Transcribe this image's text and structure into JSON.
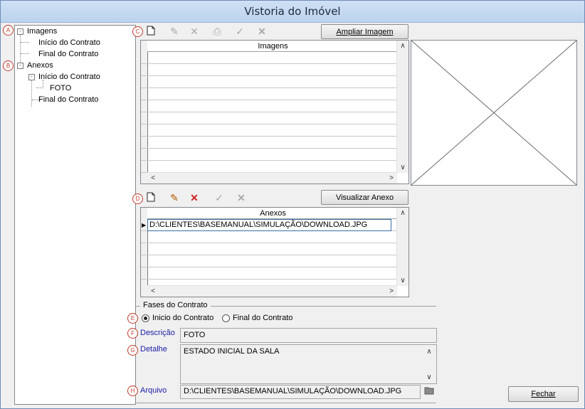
{
  "window": {
    "title": "Vistoria do Imóvel"
  },
  "tree": {
    "nodes": [
      {
        "label": "Imagens",
        "expander": "-"
      },
      {
        "label": "Início do Contrato"
      },
      {
        "label": "Final do Contrato"
      },
      {
        "label": "Anexos",
        "expander": "-"
      },
      {
        "label": "Início do Contrato",
        "expander": "-"
      },
      {
        "label": "FOTO"
      },
      {
        "label": "Final do Contrato"
      }
    ]
  },
  "markers": {
    "a": "A",
    "b": "B",
    "c": "C",
    "d": "D",
    "e": "E",
    "f": "F",
    "g": "G",
    "h": "H"
  },
  "images_panel": {
    "toolbar": {
      "new_icon": "new-document-icon",
      "edit_icon": "pencil-icon",
      "delete_icon": "x-icon",
      "print_icon": "printer-icon",
      "confirm_icon": "check-icon",
      "cancel_icon": "cancel-icon"
    },
    "zoom_button": "Ampliar Imagem",
    "grid_header": "Imagens"
  },
  "attachments_panel": {
    "view_button": "Visualizar Anexo",
    "grid_header": "Anexos",
    "rows": [
      "D:\\CLIENTES\\BASEMANUAL\\SIMULAÇÃO\\DOWNLOAD.JPG"
    ]
  },
  "phases": {
    "group_label": "Fases do Contrato",
    "option_start": "Inicio do Contrato",
    "option_end": "Final do Contrato",
    "selected": "Inicio do Contrato"
  },
  "form": {
    "description_label": "Descrição",
    "description_value": "FOTO",
    "detail_label": "Detalhe",
    "detail_value": "ESTADO INICIAL DA SALA",
    "file_label": "Arquivo",
    "file_value": "D:\\CLIENTES\\BASEMANUAL\\SIMULAÇÃO\\DOWNLOAD.JPG"
  },
  "footer": {
    "close_button": "Fechar"
  },
  "scroll_glyphs": {
    "up": "∧",
    "down": "∨",
    "left": "<",
    "right": ">"
  },
  "colors": {
    "marker": "#c0392b",
    "delete_active": "#d02020",
    "titlebar": "#bcd3ee"
  }
}
